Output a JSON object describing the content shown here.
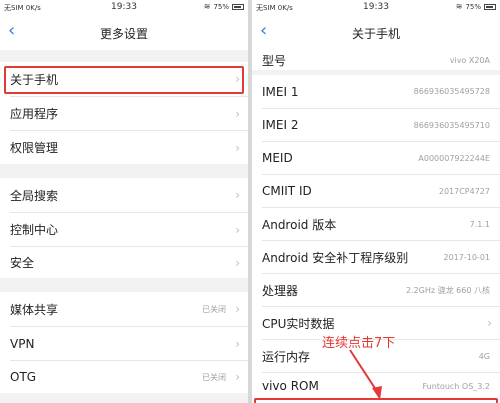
{
  "left": {
    "status": {
      "carrier": "无SIM 0K/s",
      "time": "19:33",
      "battery": "75%"
    },
    "title": "更多设置",
    "back_icon": "chevron-left-icon",
    "items": [
      {
        "label": "关于手机",
        "value": ""
      },
      {
        "label": "应用程序",
        "value": ""
      },
      {
        "label": "权限管理",
        "value": ""
      },
      {
        "label": "全局搜索",
        "value": ""
      },
      {
        "label": "控制中心",
        "value": ""
      },
      {
        "label": "安全",
        "value": ""
      },
      {
        "label": "媒体共享",
        "value": "已关闭"
      },
      {
        "label": "VPN",
        "value": ""
      },
      {
        "label": "OTG",
        "value": "已关闭"
      }
    ]
  },
  "right": {
    "status": {
      "carrier": "无SIM 0K/s",
      "time": "19:33",
      "battery": "75%"
    },
    "title": "关于手机",
    "back_icon": "chevron-left-icon",
    "items": [
      {
        "label": "型号",
        "value": "vivo X20A"
      },
      {
        "label": "IMEI 1",
        "value": "866936035495728"
      },
      {
        "label": "IMEI 2",
        "value": "866936035495710"
      },
      {
        "label": "MEID",
        "value": "A000007922244E"
      },
      {
        "label": "CMIIT ID",
        "value": "2017CP4727"
      },
      {
        "label": "Android 版本",
        "value": "7.1.1"
      },
      {
        "label": "Android 安全补丁程序级别",
        "value": "2017-10-01"
      },
      {
        "label": "处理器",
        "value": "2.2GHz 骁龙 660 八核"
      },
      {
        "label": "CPU实时数据",
        "value": ""
      },
      {
        "label": "运行内存",
        "value": "4G"
      },
      {
        "label": "vivo ROM",
        "value": "Funtouch OS_3.2"
      }
    ]
  },
  "annotation": {
    "text": "连续点击7下",
    "color": "#e53935"
  },
  "colors": {
    "accent": "#2f7fd6",
    "highlight": "#e53935"
  }
}
